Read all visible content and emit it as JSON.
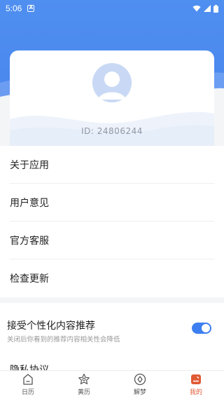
{
  "status": {
    "time": "5:06",
    "notification_icon": "a-icon",
    "icons": [
      "wifi-icon",
      "signal-icon",
      "battery-icon"
    ]
  },
  "profile": {
    "avatar_icon": "default-avatar-icon",
    "id_text": "ID: 24806244"
  },
  "menu": {
    "items": [
      {
        "label": "关于应用"
      },
      {
        "label": "用户意见"
      },
      {
        "label": "官方客服"
      },
      {
        "label": "检查更新"
      }
    ]
  },
  "settings": {
    "personalize_title": "接受个性化内容推荐",
    "personalize_sub": "关闭后你看到的推荐内容相关性会降低",
    "personalize_enabled": true,
    "privacy_label": "隐私协议"
  },
  "tabs": [
    {
      "label": "日历",
      "icon": "calendar-home-icon",
      "active": false
    },
    {
      "label": "黄历",
      "icon": "star-badge-icon",
      "active": false
    },
    {
      "label": "解梦",
      "icon": "dream-circle-icon",
      "active": false
    },
    {
      "label": "我的",
      "icon": "profile-card-icon",
      "active": true
    }
  ],
  "colors": {
    "header_blue": "#4a86ee",
    "accent_orange": "#e05a35",
    "toggle_blue": "#3d7ff0",
    "background": "#f4f5f7"
  }
}
